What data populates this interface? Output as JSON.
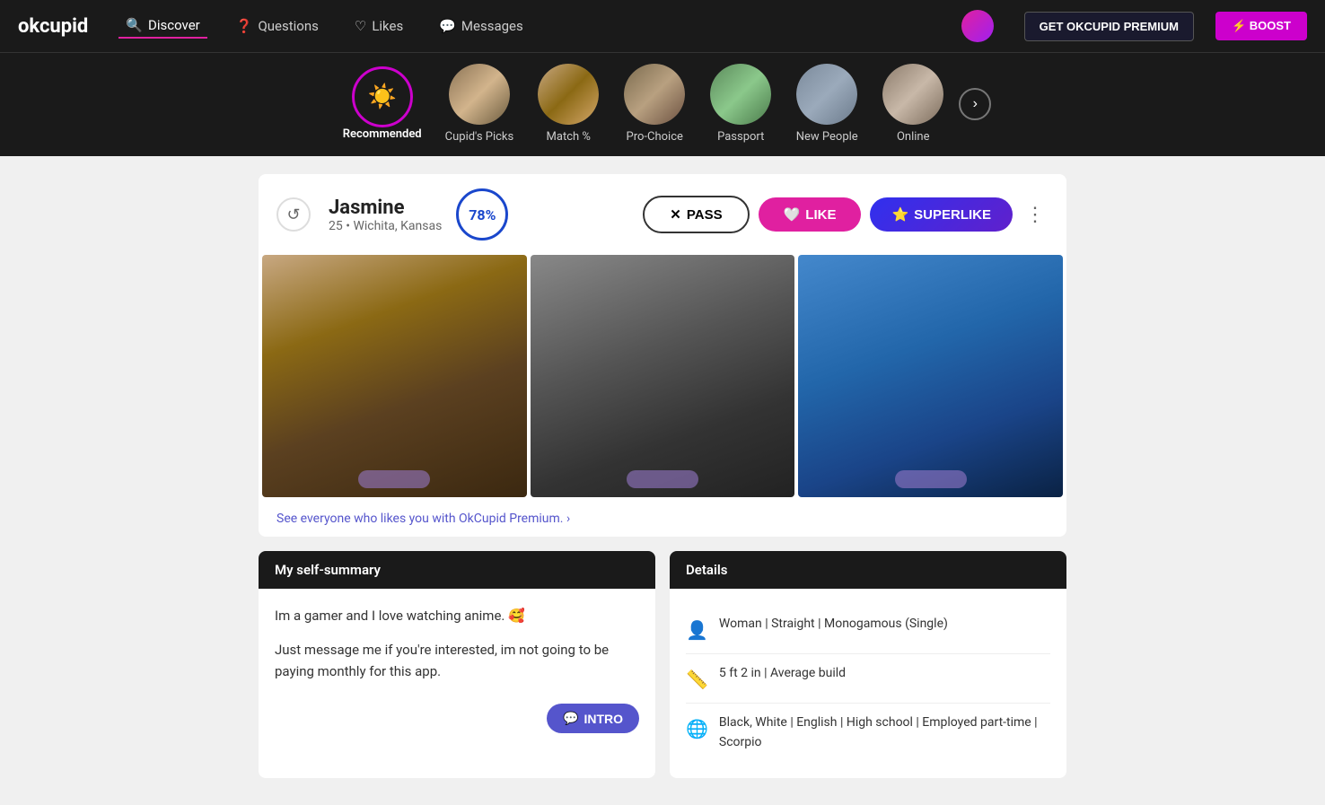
{
  "brand": "okcupid",
  "nav": {
    "items": [
      {
        "id": "discover",
        "label": "Discover",
        "active": true,
        "icon": "🔍"
      },
      {
        "id": "questions",
        "label": "Questions",
        "active": false,
        "icon": "❓"
      },
      {
        "id": "likes",
        "label": "Likes",
        "active": false,
        "icon": "♡"
      },
      {
        "id": "messages",
        "label": "Messages",
        "active": false,
        "icon": "💬"
      }
    ],
    "premium_btn": "GET OKCUPID PREMIUM",
    "boost_btn": "⚡ BOOST"
  },
  "categories": [
    {
      "id": "recommended",
      "label": "Recommended",
      "active": true,
      "icon_type": "sun"
    },
    {
      "id": "cupids_picks",
      "label": "Cupid's Picks",
      "active": false,
      "icon_type": "photo1"
    },
    {
      "id": "match",
      "label": "Match %",
      "active": false,
      "icon_type": "photo2"
    },
    {
      "id": "pro_choice",
      "label": "Pro-Choice",
      "active": false,
      "icon_type": "photo3"
    },
    {
      "id": "passport",
      "label": "Passport",
      "active": false,
      "icon_type": "photo4"
    },
    {
      "id": "new_people",
      "label": "New People",
      "active": false,
      "icon_type": "photo5"
    },
    {
      "id": "online",
      "label": "Online",
      "active": false,
      "icon_type": "photo6"
    }
  ],
  "profile": {
    "name": "Jasmine",
    "age": "25",
    "location": "Wichita, Kansas",
    "match_percent": "78%",
    "actions": {
      "pass": "PASS",
      "like": "LIKE",
      "superlike": "SUPERLIKE"
    },
    "premium_prompt": "See everyone who likes you with OkCupid Premium. ›",
    "self_summary": {
      "header": "My self-summary",
      "text1": "Im a gamer and I love watching anime. 🥰",
      "text2": "Just message me if you're interested, im not going to be paying monthly for this app.",
      "intro_btn": "INTRO"
    },
    "details": {
      "header": "Details",
      "items": [
        {
          "icon": "👤",
          "text": "Woman | Straight | Monogamous (Single)"
        },
        {
          "icon": "📏",
          "text": "5 ft 2 in | Average build"
        },
        {
          "icon": "🌐",
          "text": "Black, White | English | High school | Employed part-time | Scorpio"
        }
      ]
    }
  }
}
